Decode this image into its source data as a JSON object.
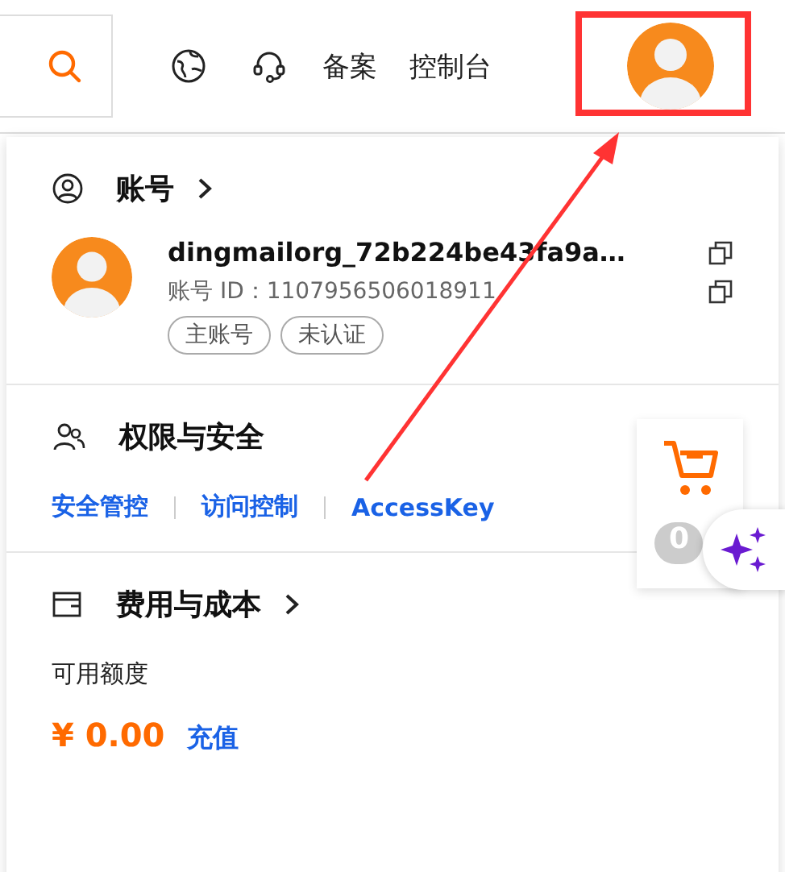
{
  "top_bar": {
    "nav_items": [
      "备案",
      "控制台"
    ]
  },
  "account": {
    "title": "账号",
    "username": "dingmailorg_72b224be43fa9a…",
    "account_id": "账号 ID：1107956506018911",
    "tags": [
      "主账号",
      "未认证"
    ]
  },
  "permissions": {
    "title": "权限与安全",
    "links": [
      "安全管控",
      "访问控制",
      "AccessKey"
    ]
  },
  "billing": {
    "title": "费用与成本",
    "balance_label": "可用额度",
    "balance": "¥ 0.00",
    "recharge": "充值"
  },
  "cart": {
    "count": "0"
  }
}
